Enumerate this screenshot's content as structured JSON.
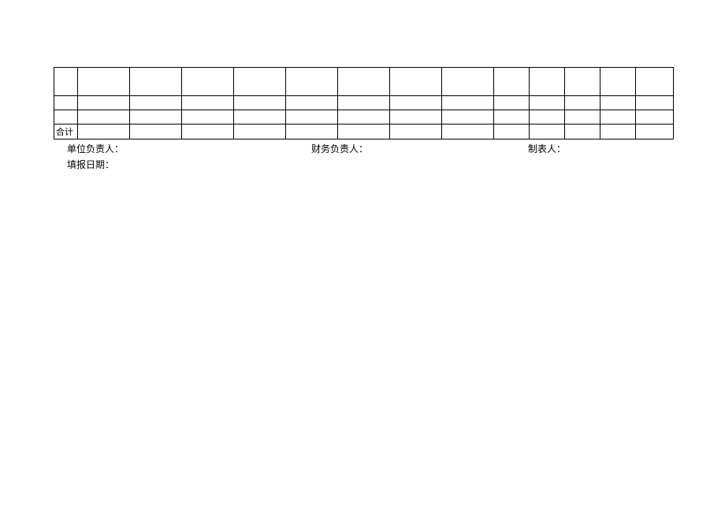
{
  "table": {
    "rows": [
      {
        "cells": [
          "",
          "",
          "",
          "",
          "",
          "",
          "",
          "",
          "",
          "",
          "",
          "",
          "",
          ""
        ]
      },
      {
        "cells": [
          "",
          "",
          "",
          "",
          "",
          "",
          "",
          "",
          "",
          "",
          "",
          "",
          "",
          ""
        ]
      },
      {
        "cells": [
          "",
          "",
          "",
          "",
          "",
          "",
          "",
          "",
          "",
          "",
          "",
          "",
          "",
          ""
        ]
      },
      {
        "cells": [
          "合计",
          "",
          "",
          "",
          "",
          "",
          "",
          "",
          "",
          "",
          "",
          "",
          "",
          ""
        ]
      }
    ]
  },
  "signatures": {
    "unit_leader_label": "单位负责人：",
    "finance_leader_label": "财务负责人：",
    "preparer_label": "制表人："
  },
  "report_date_label": "填报日期："
}
